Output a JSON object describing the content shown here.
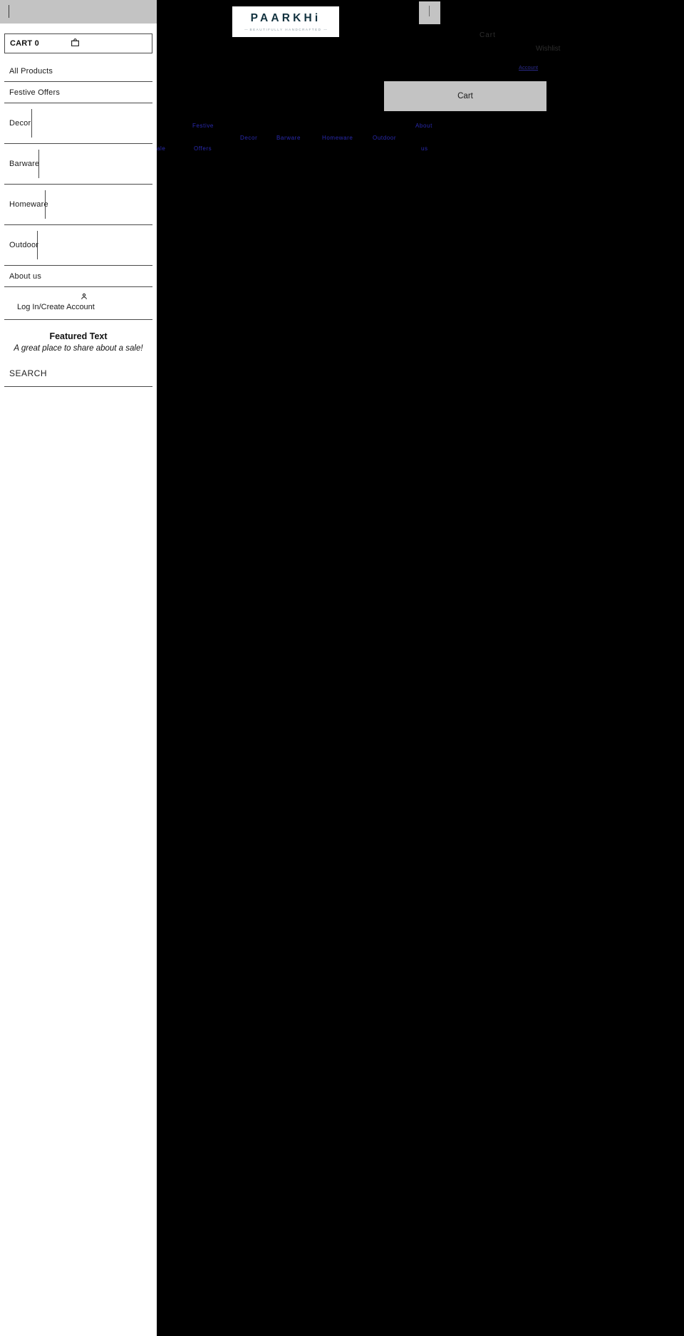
{
  "sidebar": {
    "cart": {
      "label": "CART 0",
      "icon": "shopping-bag-icon"
    },
    "menu_items": [
      {
        "label": "All Products",
        "has_submenu_rule": false
      },
      {
        "label": "Festive Offers",
        "has_submenu_rule": false
      },
      {
        "label": "Decor",
        "has_submenu_rule": true
      },
      {
        "label": "Barware",
        "has_submenu_rule": true
      },
      {
        "label": "Homeware",
        "has_submenu_rule": true
      },
      {
        "label": "Outdoor",
        "has_submenu_rule": true
      },
      {
        "label": "About us",
        "has_submenu_rule": false
      }
    ],
    "account": {
      "label": "Log In/Create Account",
      "icon": "person-icon"
    },
    "featured": {
      "title": "Featured Text",
      "subtitle": "A great place to share about a sale!"
    },
    "search": {
      "label": "SEARCH"
    }
  },
  "header": {
    "logo": {
      "word": "PAARKH",
      "word_tail": "i",
      "tagline_left": "—",
      "tagline": "BEAUTIFULLY HANDCRAFTED",
      "tagline_right": "—"
    },
    "cart_faint": "Cart",
    "wishlist_faint": "Wishlist",
    "account_faint": "Account"
  },
  "main": {
    "cart_panel": {
      "label": "Cart"
    },
    "nav_links": {
      "festive": "Festive",
      "decor": "Decor",
      "barware": "Barware",
      "homeware": "Homeware",
      "outdoor": "Outdoor",
      "about": "About",
      "sale": "ale",
      "offers": "Offers",
      "us": "us"
    }
  },
  "colors": {
    "background": "#000000",
    "sidebar_bg": "#ffffff",
    "panel_grey": "#c3c3c3",
    "logo_teal": "#12323f",
    "link_blue": "#2a2ab0",
    "rule": "#4a4a4a"
  }
}
